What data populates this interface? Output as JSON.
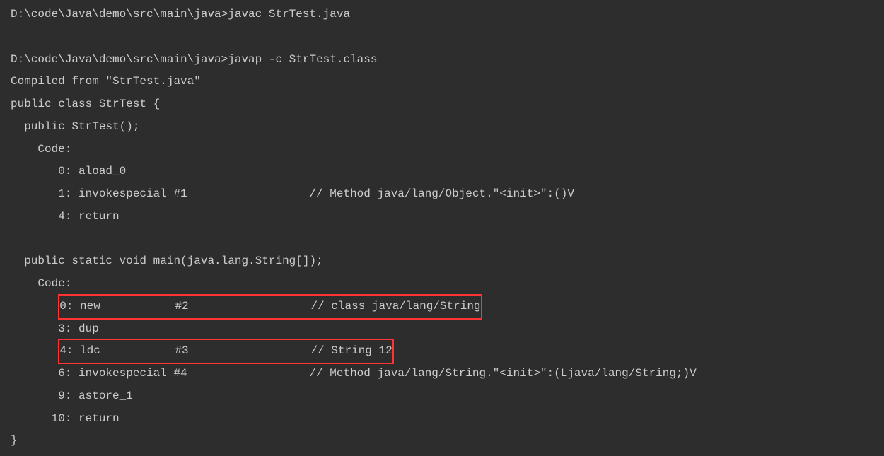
{
  "prompt1": {
    "path": "D:\\code\\Java\\demo\\src\\main\\java>",
    "command": "javac StrTest.java"
  },
  "prompt2": {
    "path": "D:\\code\\Java\\demo\\src\\main\\java>",
    "command": "javap -c StrTest.class"
  },
  "output": {
    "compiledFrom": "Compiled from \"StrTest.java\"",
    "classDecl": "public class StrTest {",
    "constructor": {
      "signature": "  public StrTest();",
      "codeLabel": "    Code:",
      "line0": "       0: aload_0",
      "line1": "       1: invokespecial #1                  // Method java/lang/Object.\"<init>\":()V",
      "line4": "       4: return"
    },
    "mainMethod": {
      "signature": "  public static void main(java.lang.String[]);",
      "codeLabel": "    Code:",
      "line0_prefix": "       ",
      "line0_box": "0: new           #2                  // class java/lang/String",
      "line3": "       3: dup",
      "line4_prefix": "       ",
      "line4_box": "4: ldc           #3                  // String 12",
      "line6": "       6: invokespecial #4                  // Method java/lang/String.\"<init>\":(Ljava/lang/String;)V",
      "line9": "       9: astore_1",
      "line10": "      10: return"
    },
    "classEnd": "}"
  }
}
